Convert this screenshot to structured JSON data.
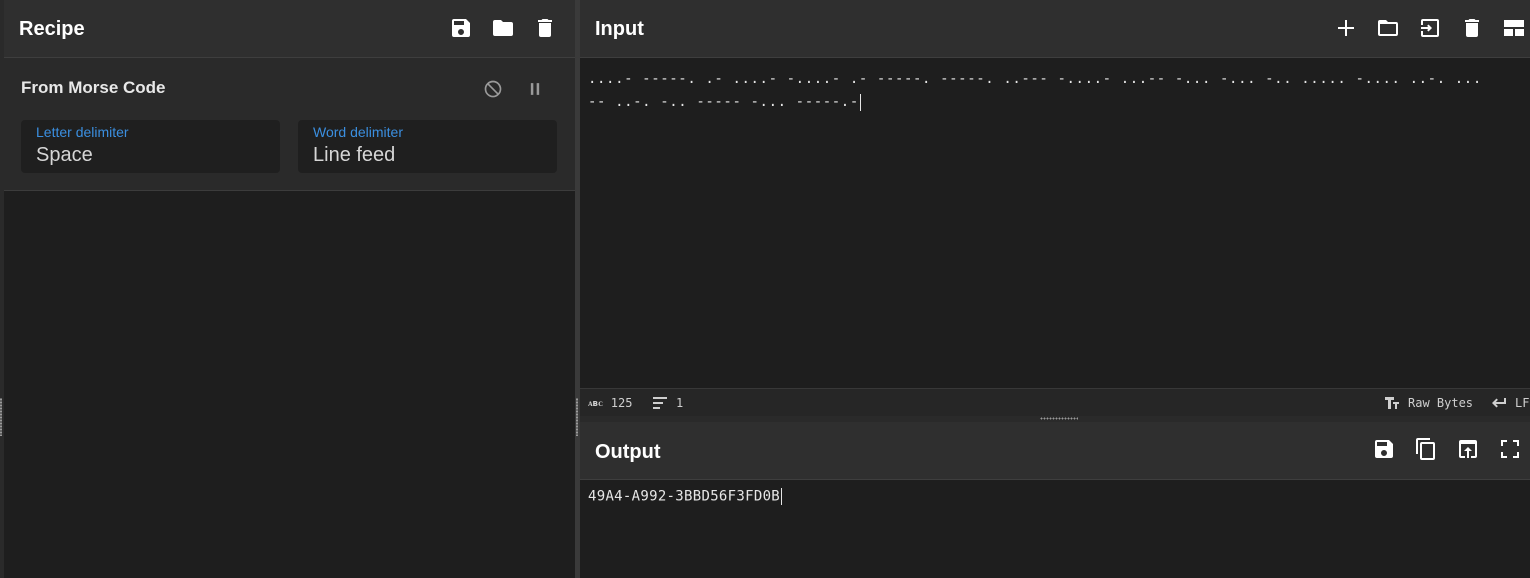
{
  "recipe": {
    "title": "Recipe",
    "icons": [
      "save-icon",
      "folder-icon",
      "trash-icon"
    ],
    "operation": {
      "name": "From Morse Code",
      "letter_delimiter": {
        "label": "Letter delimiter",
        "value": "Space"
      },
      "word_delimiter": {
        "label": "Word delimiter",
        "value": "Line feed"
      }
    }
  },
  "input": {
    "title": "Input",
    "text": "....- -----. .- ....- -....- .- -----. -----. ..--- -....- ...-- -... -... -.. ..... -.... ..-. ...-- ..-. -.. ----- -... -----.-",
    "status": {
      "chars": "125",
      "lines": "1",
      "encoding": "Raw Bytes",
      "eol": "LF"
    }
  },
  "output": {
    "title": "Output",
    "text": "49A4-A992-3BBD56F3FD0B"
  }
}
